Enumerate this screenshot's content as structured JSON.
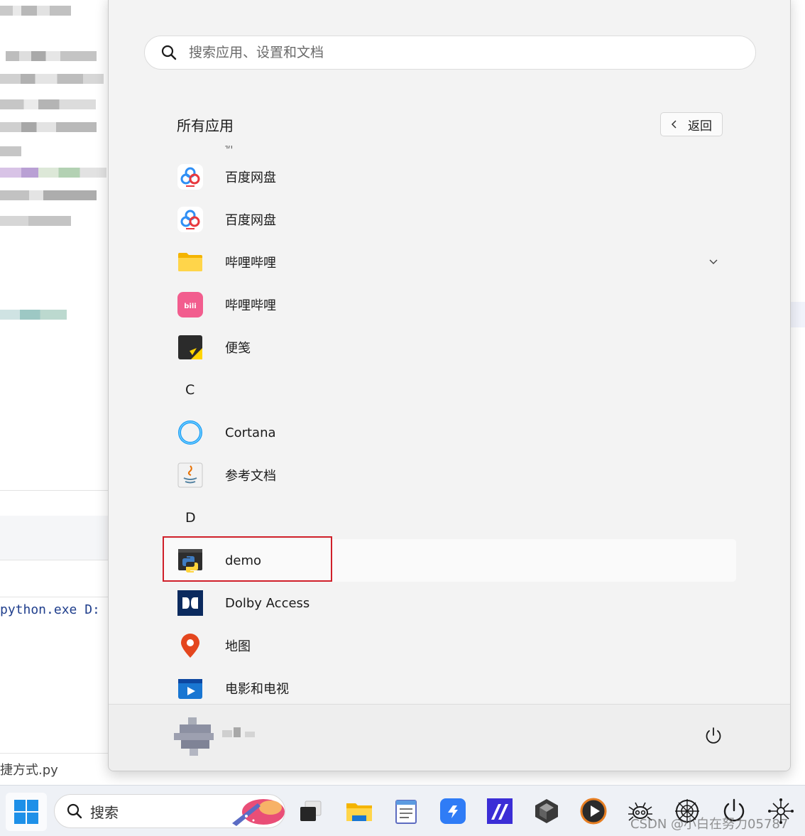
{
  "background_editor": {
    "code_line": "python.exe D:",
    "file_label": "捷方式.py"
  },
  "start_menu": {
    "search": {
      "placeholder": "搜索应用、设置和文档"
    },
    "section_title": "所有应用",
    "back_button": {
      "label": "返回"
    },
    "partial_item_label": "析",
    "apps": [
      {
        "label": "百度网盘",
        "icon": "baidu-netdisk-icon"
      },
      {
        "label": "百度网盘",
        "icon": "baidu-netdisk-icon"
      },
      {
        "label": "哔哩哔哩",
        "icon": "folder-icon",
        "expandable": true
      },
      {
        "label": "哔哩哔哩",
        "icon": "bilibili-icon"
      },
      {
        "label": "便笺",
        "icon": "sticky-notes-icon"
      },
      {
        "letter": "C"
      },
      {
        "label": "Cortana",
        "icon": "cortana-icon"
      },
      {
        "label": "参考文档",
        "icon": "java-docs-icon"
      },
      {
        "letter": "D"
      },
      {
        "label": "demo",
        "icon": "python-app-icon",
        "selected": true
      },
      {
        "label": "Dolby Access",
        "icon": "dolby-icon"
      },
      {
        "label": "地图",
        "icon": "maps-icon"
      },
      {
        "label": "电影和电视",
        "icon": "movies-tv-icon"
      }
    ],
    "footer": {
      "power_icon": "power-icon"
    }
  },
  "taskbar": {
    "search_label": "搜索",
    "icons": [
      "windows-start-icon",
      "search-icon",
      "task-view-icon",
      "file-explorer-icon",
      "notepad-icon",
      "link-app-icon",
      "ide-icon",
      "unity-icon",
      "media-player-icon",
      "bug-icon",
      "web-icon",
      "power-icon",
      "network-icon"
    ]
  },
  "watermark": "CSDN @小白在努力05787",
  "colors": {
    "menu_bg": "#f3f3f3",
    "taskbar_bg": "#eef1f6",
    "highlight_border": "#d0202a",
    "accent_blue": "#0078d4"
  }
}
